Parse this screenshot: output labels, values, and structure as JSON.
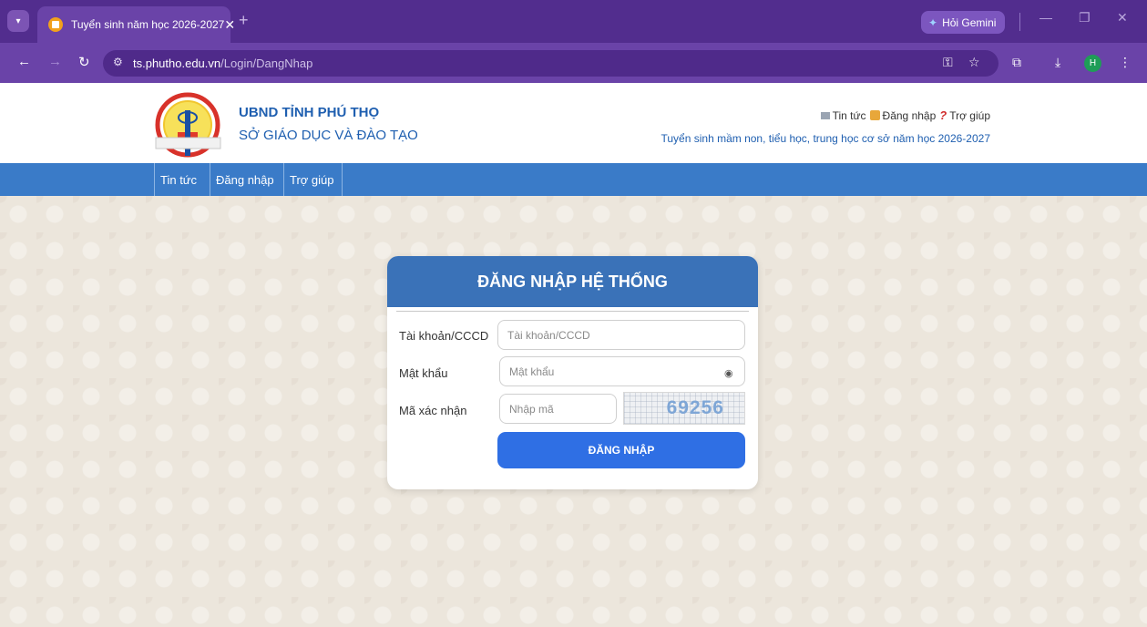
{
  "browser": {
    "tab_title": "Tuyển sinh năm học 2026-2027",
    "tab_close": "✕",
    "new_tab": "+",
    "gemini_label": "Hỏi Gemini",
    "avatar_letter": "H",
    "url_host": "ts.phutho.edu.vn",
    "url_path": "/Login/DangNhap"
  },
  "header": {
    "org_line1": "UBND TỈNH PHÚ THỌ",
    "org_line2": "SỞ GIÁO DỤC VÀ ĐÀO TẠO",
    "links": {
      "news": "Tin tức",
      "login": "Đăng nhập",
      "help": "Trợ giúp"
    },
    "subtitle": "Tuyển sinh mầm non, tiểu học, trung học cơ sở năm học 2026-2027",
    "logo_text": "GDĐT ĐẤT TỔ"
  },
  "navbar": {
    "items": [
      "Tin tức",
      "Đăng nhập",
      "Trợ giúp"
    ]
  },
  "login": {
    "title": "ĐĂNG NHẬP HỆ THỐNG",
    "account_label": "Tài khoản/CCCD",
    "account_placeholder": "Tài khoản/CCCD",
    "password_label": "Mật khẩu",
    "password_placeholder": "Mật khẩu",
    "captcha_label": "Mã xác nhận",
    "captcha_placeholder": "Nhập mã",
    "captcha_value": "69256",
    "submit_label": "ĐĂNG NHẬP"
  },
  "colors": {
    "chrome_dark": "#522d8e",
    "chrome_toolbar": "#6a43a8",
    "brand_blue": "#1f5fb0",
    "navbar_blue": "#3a7bc8",
    "card_header": "#3a72b8",
    "submit_button": "#2f6fe4"
  }
}
